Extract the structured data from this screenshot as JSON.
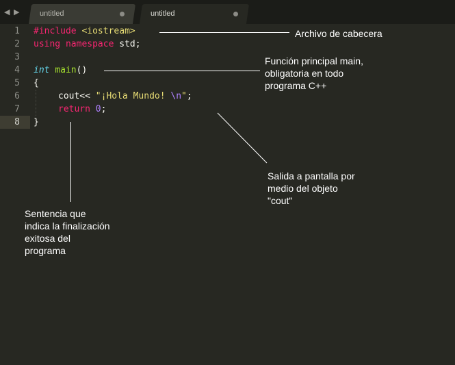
{
  "tabs": [
    {
      "label": "untitled"
    },
    {
      "label": "untitled"
    }
  ],
  "nav": {
    "back": "◀",
    "forward": "▶"
  },
  "line_numbers": [
    "1",
    "2",
    "3",
    "4",
    "5",
    "6",
    "7",
    "8"
  ],
  "code": {
    "l1_kw": "#include",
    "l1_str": "<iostream>",
    "l2_kw1": "using",
    "l2_kw2": "namespace",
    "l2_rest": " std;",
    "l4_type": "int",
    "l4_fn": "main",
    "l4_rest": "()",
    "l5": "{",
    "l6_a": "cout<< ",
    "l6_str": "\"¡Hola Mundo! ",
    "l6_esc": "\\n",
    "l6_str_end": "\"",
    "l6_semi": ";",
    "l7_kw": "return",
    "l7_num": "0",
    "l7_semi": ";",
    "l8": "}"
  },
  "annotations": {
    "header": "Archivo de cabecera",
    "main_1": "Función principal main,",
    "main_2": "obligatoria en todo",
    "main_3": "programa C++",
    "cout_1": "Salida a pantalla por",
    "cout_2": "medio del objeto",
    "cout_3": "\"cout\"",
    "return_1": "Sentencia que",
    "return_2": "indica la finalización",
    "return_3": "exitosa del",
    "return_4": "programa"
  },
  "colors": {
    "background": "#272822",
    "keyword": "#f92672",
    "string": "#e6db74",
    "type": "#66d9ef",
    "function": "#a6e22e",
    "number": "#ae81ff"
  }
}
